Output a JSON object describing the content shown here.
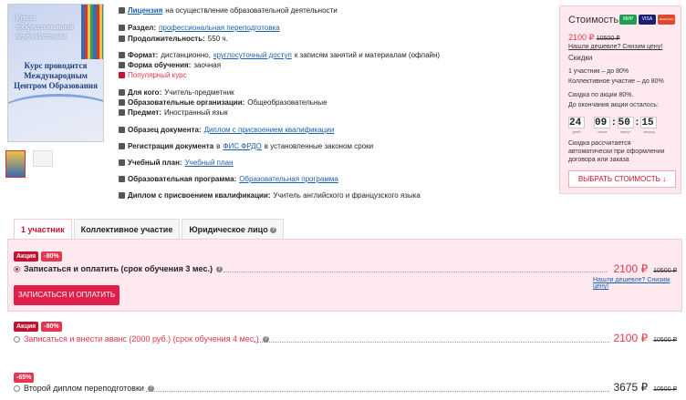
{
  "cover": {
    "title": "Курсы профессиональной переподготовки",
    "subtitle": "Курс проводится Международным Центром Образования"
  },
  "details": [
    {
      "icon": "license-icon",
      "label": "Лицензия",
      "value": "на осуществление образовательной деятельности",
      "label_link": true
    },
    {
      "icon": "section-icon",
      "label": "Раздел:",
      "value": "профессиональная переподготовка",
      "link": true
    },
    {
      "icon": "clock-icon",
      "label": "Продолжительность:",
      "value": "550 ч."
    },
    {
      "icon": "monitor-icon",
      "label": "Формат:",
      "value_pre": "дистанционно,",
      "value_link": "круглосуточный доступ",
      "value_post": "к записям занятий и материалам (офлайн)"
    },
    {
      "icon": "monitor-icon",
      "label": "Форма обучения:",
      "value": "заочная"
    },
    {
      "icon": "fire-icon",
      "label": "",
      "value": "Популярный курс"
    },
    {
      "icon": "user-icon",
      "label": "Для кого:",
      "value": "Учитель-предметник"
    },
    {
      "icon": "building-icon",
      "label": "Образовательные организации:",
      "value": "Общеобразовательные"
    },
    {
      "icon": "subject-icon",
      "label": "Предмет:",
      "value": "Иностранный язык"
    },
    {
      "icon": "document-icon",
      "label": "Образец документа:",
      "value": "Диплом с присвоением квалификации",
      "link": true
    },
    {
      "icon": "check-icon",
      "label": "Регистрация документа",
      "value_pre": "в",
      "value_link": "ФИС ФРДО",
      "value_post": "в установленные законом сроки"
    },
    {
      "icon": "plan-icon",
      "label": "Учебный план:",
      "value": "Учебный план",
      "link": true
    },
    {
      "icon": "program-icon",
      "label": "Образовательная программа:",
      "value": "Образовательная программа",
      "link": true
    },
    {
      "icon": "flag-icon",
      "label": "Диплом с присвоением квалификации:",
      "value": "Учитель английского и французского языка"
    }
  ],
  "sidebar": {
    "title": "Стоимость",
    "cards": [
      {
        "name": "МИР",
        "color": "#1f9d55"
      },
      {
        "name": "VISA",
        "color": "#1a1f71"
      },
      {
        "name": "MasterCard",
        "color": "#e04a2c"
      }
    ],
    "price": "2100 ₽",
    "old_price": "10500 ₽",
    "cheaper": "Нашли дешевле? Снизим цену!",
    "discounts_title": "Скидки",
    "discount_1": "1 участник – до 80%",
    "discount_2": "Коллективное участие – до 80%",
    "promo": "Скидка по акции 80%.",
    "until_end": "До окончания акции осталось:",
    "timer": {
      "days": "24",
      "hours": "09",
      "minutes": "50",
      "seconds": "15",
      "days_label": "дней",
      "hours_label": "часов",
      "minutes_label": "минут",
      "seconds_label": "секунд"
    },
    "note": "Скидка рассчитается автоматически при оформлении договора или заказа",
    "choose_button": "ВЫБРАТЬ СТОИМОСТЬ ↓"
  },
  "tabs": [
    "1 участник",
    "Коллективное участие",
    "Юридическое лицо"
  ],
  "options": [
    {
      "badge1": "Акция",
      "badge2": "-80%",
      "label": "Записаться и оплатить (срок обучения 3 мес.)",
      "price": "2100 ₽",
      "old_price": "10500 ₽",
      "cheaper": "Нашли дешевле? Снизим цену!",
      "button": "ЗАПИСАТЬСЯ И ОПЛАТИТЬ",
      "selected": true
    },
    {
      "badge1": "Акция",
      "badge2": "-80%",
      "label": "Записаться и внести аванс (2000 руб.) (срок обучения 4 мес.)",
      "price": "2100 ₽",
      "old_price": "10500 ₽"
    },
    {
      "badge1": "-65%",
      "label": "Второй диплом переподготовки",
      "price": "3675 ₽",
      "old_price": "10500 ₽"
    }
  ]
}
